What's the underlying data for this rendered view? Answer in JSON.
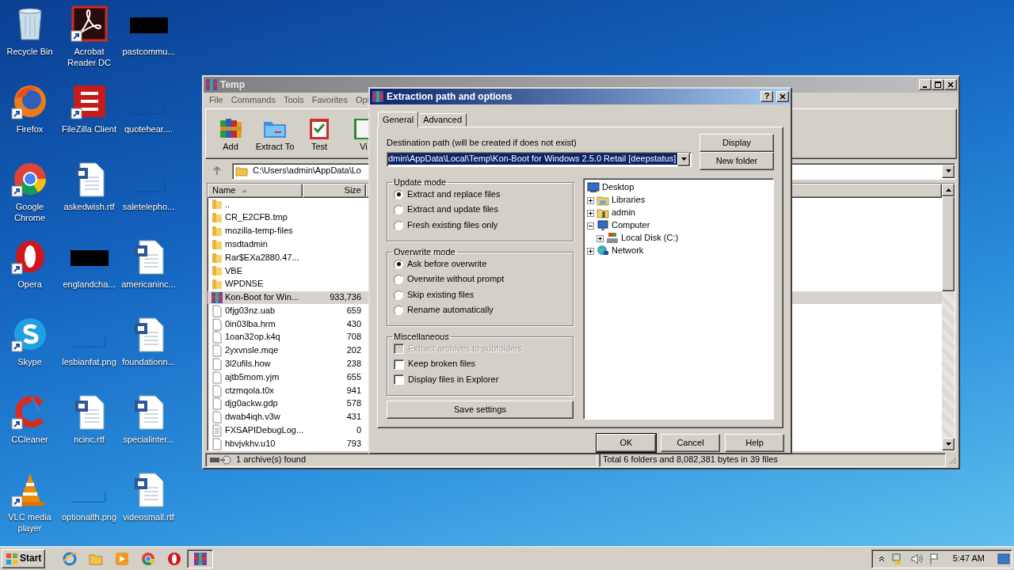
{
  "desktop_icons": [
    {
      "label": "Recycle Bin",
      "kind": "recycle",
      "shortcut": false
    },
    {
      "label": "Firefox",
      "kind": "firefox",
      "shortcut": true
    },
    {
      "label": "Google Chrome",
      "kind": "chrome",
      "shortcut": true
    },
    {
      "label": "Opera",
      "kind": "opera",
      "shortcut": true
    },
    {
      "label": "Skype",
      "kind": "skype",
      "shortcut": true
    },
    {
      "label": "CCleaner",
      "kind": "ccleaner",
      "shortcut": true
    },
    {
      "label": "VLC media player",
      "kind": "vlc",
      "shortcut": true
    },
    {
      "label": "Acrobat Reader DC",
      "kind": "acrobat",
      "shortcut": true
    },
    {
      "label": "FileZilla Client",
      "kind": "filezilla",
      "shortcut": true
    },
    {
      "label": "askedwish.rtf",
      "kind": "doc",
      "shortcut": false
    },
    {
      "label": "englandcha...",
      "kind": "redacted",
      "shortcut": false
    },
    {
      "label": "lesbianfat.png",
      "kind": "image",
      "shortcut": false
    },
    {
      "label": "ncinc.rtf",
      "kind": "doc",
      "shortcut": false
    },
    {
      "label": "optionalth.png",
      "kind": "image",
      "shortcut": false
    },
    {
      "label": "pastcommu...",
      "kind": "redacted",
      "shortcut": false
    },
    {
      "label": "quotehear....",
      "kind": "image",
      "shortcut": false
    },
    {
      "label": "saletelepho...",
      "kind": "image",
      "shortcut": false
    },
    {
      "label": "americaninc...",
      "kind": "doc",
      "shortcut": false
    },
    {
      "label": "foundationn...",
      "kind": "doc",
      "shortcut": false
    },
    {
      "label": "specialinter...",
      "kind": "doc",
      "shortcut": false
    },
    {
      "label": "videosmall.rtf",
      "kind": "doc",
      "shortcut": false
    }
  ],
  "winrar": {
    "title": "Temp",
    "menu": [
      "File",
      "Commands",
      "Tools",
      "Favorites",
      "Opt"
    ],
    "toolbar": [
      {
        "label": "Add",
        "kind": "add"
      },
      {
        "label": "Extract To",
        "kind": "extract"
      },
      {
        "label": "Test",
        "kind": "test"
      },
      {
        "label": "Vi",
        "kind": "view"
      }
    ],
    "address": "C:\\Users\\admin\\AppData\\Lo",
    "columns": [
      "Name",
      "Size"
    ],
    "files": [
      {
        "name": "..",
        "kind": "folder",
        "selected": false
      },
      {
        "name": "CR_E2CFB.tmp",
        "kind": "folder",
        "selected": false
      },
      {
        "name": "mozilla-temp-files",
        "kind": "folder",
        "selected": false
      },
      {
        "name": "msdtadmin",
        "kind": "folder",
        "selected": false
      },
      {
        "name": "Rar$EXa2880.47...",
        "kind": "folder",
        "selected": false
      },
      {
        "name": "VBE",
        "kind": "folder",
        "selected": false
      },
      {
        "name": "WPDNSE",
        "kind": "folder",
        "selected": false
      },
      {
        "name": "Kon-Boot for Win...",
        "kind": "archive",
        "size": "933,736",
        "selected": true
      },
      {
        "name": "0fjg03nz.uab",
        "kind": "file",
        "size": "659",
        "selected": false
      },
      {
        "name": "0in03lba.hrm",
        "kind": "file",
        "size": "430",
        "selected": false
      },
      {
        "name": "1oan32op.k4q",
        "kind": "file",
        "size": "708",
        "selected": false
      },
      {
        "name": "2yxvnsle.mqe",
        "kind": "file",
        "size": "202",
        "selected": false
      },
      {
        "name": "3l2ufils.how",
        "kind": "file",
        "size": "238",
        "selected": false
      },
      {
        "name": "ajtb5mom.yjm",
        "kind": "file",
        "size": "655",
        "selected": false
      },
      {
        "name": "ctzmqola.t0x",
        "kind": "file",
        "size": "941",
        "selected": false
      },
      {
        "name": "djg0ackw.gdp",
        "kind": "file",
        "size": "578",
        "selected": false
      },
      {
        "name": "dwab4iqh.v3w",
        "kind": "file",
        "size": "431",
        "selected": false
      },
      {
        "name": "FXSAPIDebugLog...",
        "kind": "text",
        "size": "0",
        "selected": false
      },
      {
        "name": "hbvjvkhv.u10",
        "kind": "file",
        "size": "793",
        "selected": false
      }
    ],
    "status_left": "1 archive(s) found",
    "status_right": "Total 6 folders and 8,082,381 bytes in 39 files"
  },
  "dialog": {
    "title": "Extraction path and options",
    "help_button": "?",
    "tabs": [
      {
        "label": "General",
        "selected": true
      },
      {
        "label": "Advanced",
        "selected": false
      }
    ],
    "path_label": "Destination path (will be created if does not exist)",
    "path_value": "dmin\\AppData\\Local\\Temp\\Kon-Boot for Windows 2.5.0 Retail [deepstatus]",
    "side_buttons": [
      "Display",
      "New folder"
    ],
    "groups": [
      {
        "title": "Update mode",
        "kind": "radio",
        "options": [
          {
            "label": "Extract and replace files",
            "selected": true
          },
          {
            "label": "Extract and update files",
            "selected": false
          },
          {
            "label": "Fresh existing files only",
            "selected": false
          }
        ]
      },
      {
        "title": "Overwrite mode",
        "kind": "radio",
        "options": [
          {
            "label": "Ask before overwrite",
            "selected": true
          },
          {
            "label": "Overwrite without prompt",
            "selected": false
          },
          {
            "label": "Skip existing files",
            "selected": false
          },
          {
            "label": "Rename automatically",
            "selected": false
          }
        ]
      },
      {
        "title": "Miscellaneous",
        "kind": "checkbox",
        "options": [
          {
            "label": "Extract archives to subfolders",
            "checked": false,
            "disabled": true
          },
          {
            "label": "Keep broken files",
            "checked": false,
            "disabled": false
          },
          {
            "label": "Display files in Explorer",
            "checked": false,
            "disabled": false
          }
        ]
      }
    ],
    "save_button": "Save settings",
    "tree": {
      "label": "Desktop",
      "kind": "desktop",
      "children": [
        {
          "label": "Libraries",
          "kind": "library",
          "expanded": false
        },
        {
          "label": "admin",
          "kind": "user",
          "expanded": false
        },
        {
          "label": "Computer",
          "kind": "computer",
          "expanded": true,
          "children": [
            {
              "label": "Local Disk (C:)",
              "kind": "disk",
              "expanded": false
            }
          ]
        },
        {
          "label": "Network",
          "kind": "network",
          "expanded": false
        }
      ]
    },
    "buttons": [
      {
        "label": "OK",
        "default": true
      },
      {
        "label": "Cancel",
        "default": false
      },
      {
        "label": "Help",
        "default": false
      }
    ]
  },
  "taskbar": {
    "start": "Start",
    "apps": [
      {
        "kind": "ie",
        "active": false
      },
      {
        "kind": "explorer",
        "active": false
      },
      {
        "kind": "media",
        "active": false
      },
      {
        "kind": "chrome",
        "active": false
      },
      {
        "kind": "opera",
        "active": false
      },
      {
        "kind": "winrar",
        "active": true
      }
    ],
    "clock": "5:47 AM"
  }
}
